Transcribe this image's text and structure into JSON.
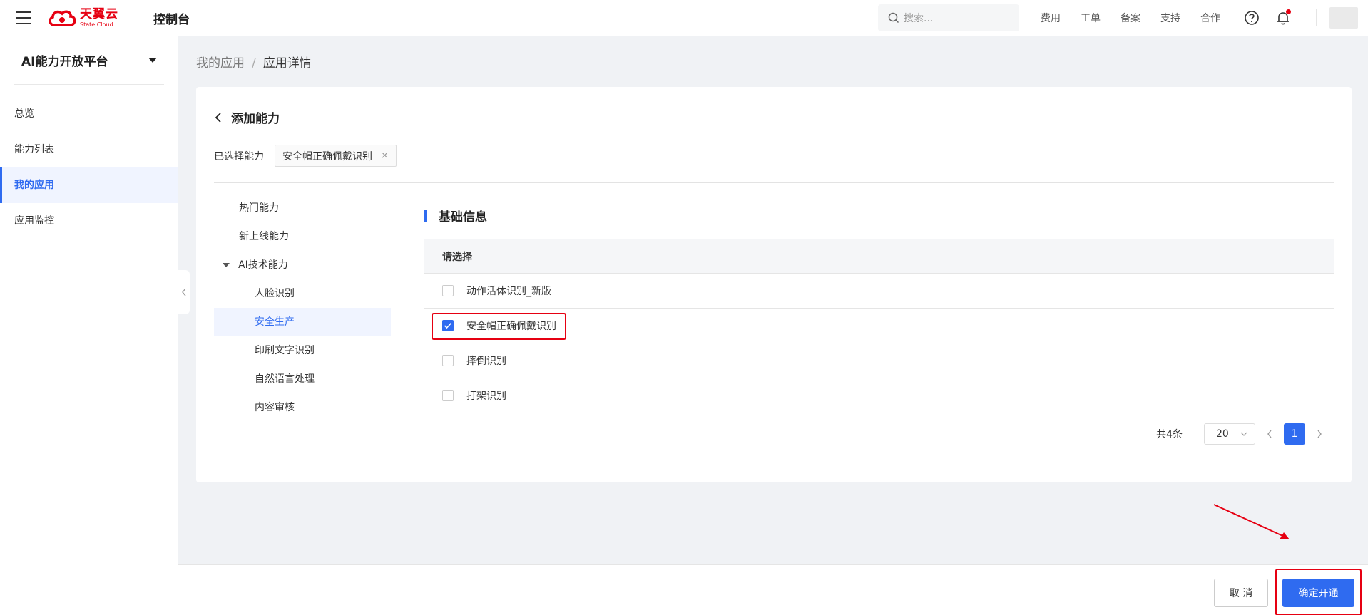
{
  "topbar": {
    "logo_cn": "天翼云",
    "logo_en": "State Cloud",
    "console_title": "控制台",
    "search_placeholder": "搜索...",
    "nav_links": [
      "费用",
      "工单",
      "备案",
      "支持",
      "合作"
    ]
  },
  "sidebar": {
    "title": "AI能力开放平台",
    "items": [
      {
        "label": "总览"
      },
      {
        "label": "能力列表"
      },
      {
        "label": "我的应用"
      },
      {
        "label": "应用监控"
      }
    ]
  },
  "breadcrumb": {
    "root": "我的应用",
    "separator": "/",
    "current": "应用详情"
  },
  "card": {
    "title": "添加能力",
    "selected_label": "已选择能力",
    "selected_tag": "安全帽正确佩戴识别",
    "tag_close": "×"
  },
  "tree": {
    "hot": "热门能力",
    "new": "新上线能力",
    "group": "AI技术能力",
    "children": [
      "人脸识别",
      "安全生产",
      "印刷文字识别",
      "自然语言处理",
      "内容审核"
    ]
  },
  "section": {
    "title": "基础信息",
    "table_header": "请选择",
    "rows": [
      {
        "label": "动作活体识别_新版",
        "checked": false
      },
      {
        "label": "安全帽正确佩戴识别",
        "checked": true
      },
      {
        "label": "摔倒识别",
        "checked": false
      },
      {
        "label": "打架识别",
        "checked": false
      }
    ]
  },
  "pager": {
    "total": "共4条",
    "page_size": "20",
    "current_page": "1"
  },
  "footer": {
    "cancel": "取 消",
    "confirm": "确定开通"
  },
  "colors": {
    "accent": "#2f6bf0",
    "brand_red": "#e60012"
  }
}
